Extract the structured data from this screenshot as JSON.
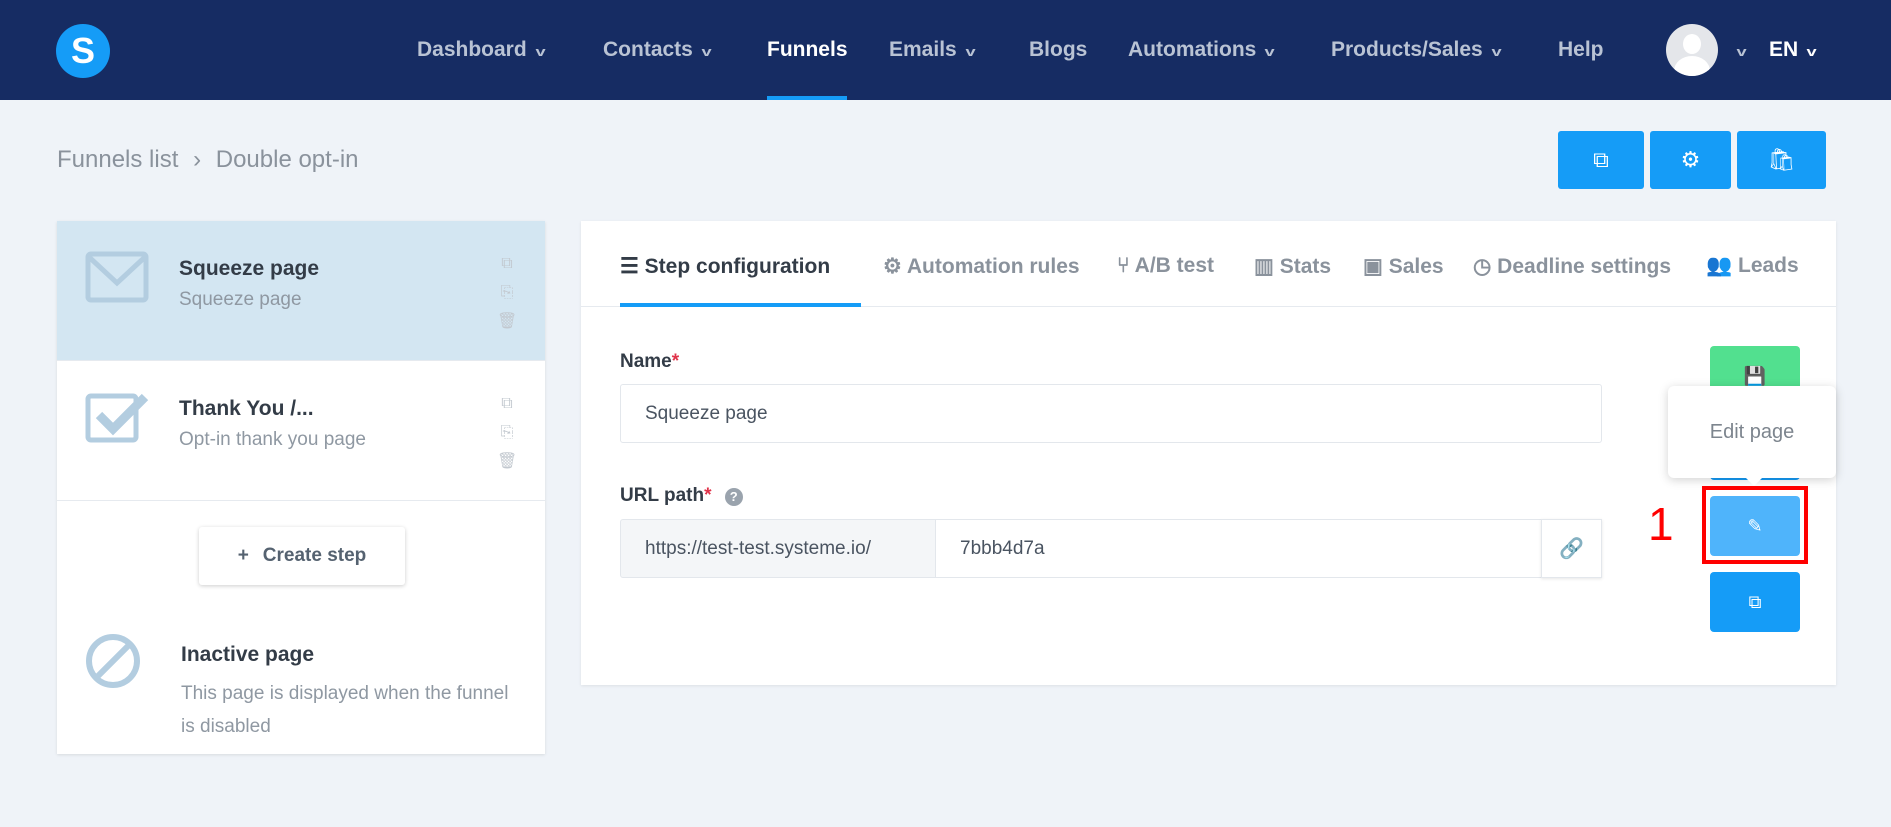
{
  "nav": {
    "logo": "S",
    "items": [
      {
        "label": "Dashboard",
        "dropdown": true
      },
      {
        "label": "Contacts",
        "dropdown": true
      },
      {
        "label": "Funnels",
        "dropdown": false,
        "active": true
      },
      {
        "label": "Emails",
        "dropdown": true
      },
      {
        "label": "Blogs",
        "dropdown": false
      },
      {
        "label": "Automations",
        "dropdown": true
      },
      {
        "label": "Products/Sales",
        "dropdown": true
      },
      {
        "label": "Help",
        "dropdown": false
      }
    ],
    "language": "EN"
  },
  "breadcrumb": {
    "parent": "Funnels list",
    "separator": "›",
    "current": "Double opt-in"
  },
  "toolbar": {
    "icons": [
      "external-link-icon",
      "gear-icon",
      "shopping-bag-icon"
    ]
  },
  "steps": [
    {
      "title": "Squeeze page",
      "subtitle": "Squeeze page",
      "icon": "envelope-icon",
      "selected": true
    },
    {
      "title": "Thank You /...",
      "subtitle": "Opt-in thank you page",
      "icon": "checkbox-icon",
      "selected": false
    }
  ],
  "create_step": {
    "plus": "+",
    "label": "Create step"
  },
  "inactive": {
    "title": "Inactive page",
    "description": "This page is displayed when the funnel is disabled"
  },
  "tabs": [
    {
      "label": "Step configuration",
      "icon": "☰"
    },
    {
      "label": "Automation rules",
      "icon": "⚙"
    },
    {
      "label": "A/B test",
      "icon": "⑂"
    },
    {
      "label": "Stats",
      "icon": "▥"
    },
    {
      "label": "Sales",
      "icon": "▣"
    },
    {
      "label": "Deadline settings",
      "icon": "◷"
    },
    {
      "label": "Leads",
      "icon": "👥"
    }
  ],
  "form": {
    "name_label": "Name",
    "required": "*",
    "name_value": "Squeeze page",
    "url_label": "URL path",
    "help": "?",
    "url_prefix": "https://test-test.systeme.io/",
    "url_value": "7bbb4d7a"
  },
  "tooltip": "Edit page",
  "annotation": "1",
  "colors": {
    "nav": "#162c63",
    "accent": "#159cf7",
    "save": "#52e08f",
    "highlight": "#ff0000"
  }
}
